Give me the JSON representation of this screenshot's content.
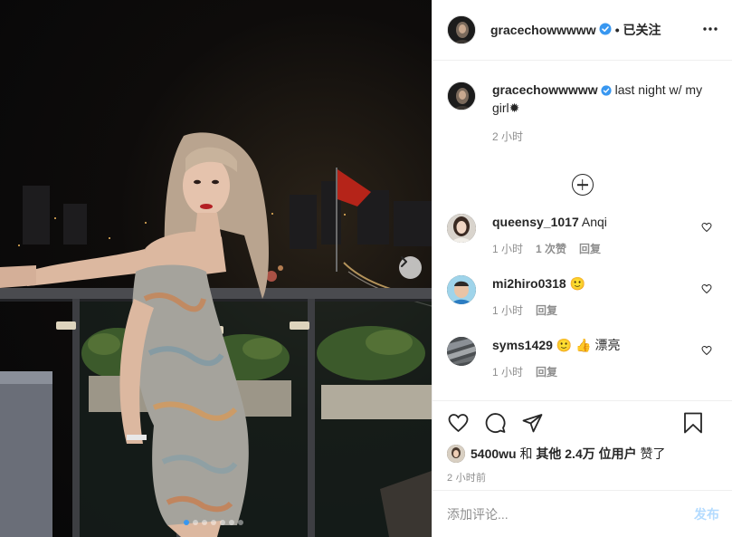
{
  "post": {
    "author": "gracechowwwww",
    "follow_label": "• 已关注",
    "caption_text": "last night w/ my girl",
    "caption_emoji": "✹",
    "time": "2 小时"
  },
  "photo": {
    "carousel_count": 7,
    "active_index": 0
  },
  "comments": [
    {
      "user": "queensy_1017",
      "text": "Anqi",
      "time": "1 小时",
      "likes": "1 次赞",
      "reply": "回复"
    },
    {
      "user": "mi2hiro0318",
      "text": "🙂",
      "time": "1 小时",
      "likes": "",
      "reply": "回复"
    },
    {
      "user": "syms1429",
      "text": "🙂 👍 漂亮",
      "time": "1 小时",
      "likes": "",
      "reply": "回复"
    }
  ],
  "likes": {
    "user": "5400wu",
    "and": "和",
    "others": "其他 2.4万 位用户",
    "suffix": "赞了"
  },
  "timestamp": "2 小时前",
  "composer": {
    "placeholder": "添加评论...",
    "post_label": "发布"
  },
  "colors": {
    "verified": "#3897f0",
    "secondary_text": "#8e8e8e",
    "post_button_disabled": "#b3dbff"
  }
}
